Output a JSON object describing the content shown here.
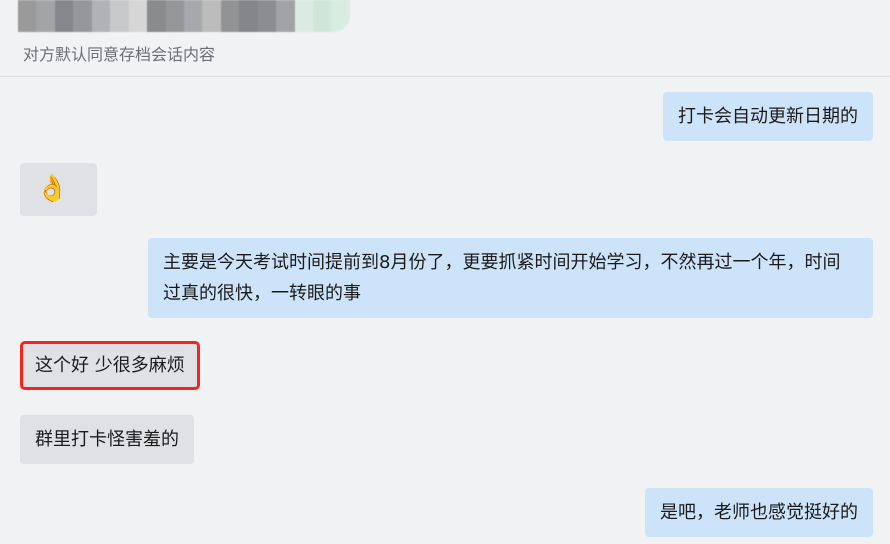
{
  "header": {
    "title_blurred": "",
    "subtitle": "对方默认同意存档会话内容"
  },
  "messages": [
    {
      "side": "sent",
      "text": "打卡会自动更新日期的"
    },
    {
      "side": "received",
      "text": "👌",
      "icon": "ok-hand-emoji"
    },
    {
      "side": "sent",
      "text": "主要是今天考试时间提前到8月份了，更要抓紧时间开始学习，不然再过一个年，时间过真的很快，一转眼的事"
    },
    {
      "side": "received",
      "text": "这个好 少很多麻烦",
      "highlighted": true,
      "highlight_color": "#f5231b"
    },
    {
      "side": "received",
      "text": "群里打卡怪害羞的"
    },
    {
      "side": "sent",
      "text": "是吧，老师也感觉挺好的"
    }
  ],
  "colors": {
    "background": "#f1f2f4",
    "received_bubble": "#e0e1e5",
    "sent_bubble": "#cce3fa"
  }
}
